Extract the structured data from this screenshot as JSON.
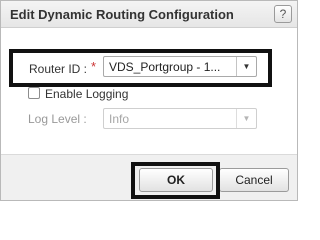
{
  "dialog": {
    "title": "Edit Dynamic Routing Configuration",
    "help_glyph": "?"
  },
  "router_id": {
    "label": "Router ID :",
    "required_mark": "*",
    "value": "VDS_Portgroup - 1...",
    "arrow_icon": "▼"
  },
  "logging": {
    "checkbox_label": "Enable Logging",
    "checked": false
  },
  "log_level": {
    "label": "Log Level :",
    "value": "Info",
    "arrow_icon": "▼"
  },
  "buttons": {
    "ok": "OK",
    "cancel": "Cancel"
  }
}
